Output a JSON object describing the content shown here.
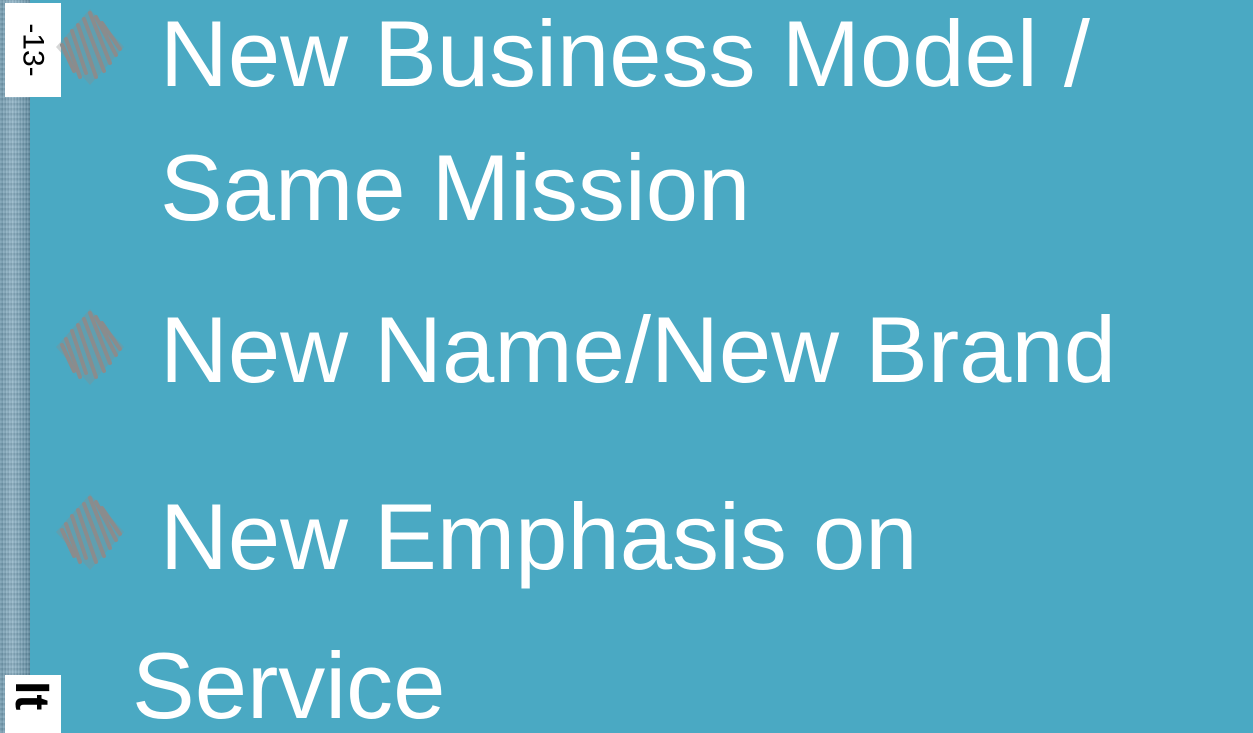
{
  "page_number": "-13-",
  "corner_fragment": "It",
  "bullets": [
    {
      "lines": [
        "New Business Model /",
        "Same Mission"
      ],
      "icon": "diamond-scribble-icon"
    },
    {
      "lines": [
        "New Name/New Brand"
      ],
      "icon": "diamond-scribble-icon"
    },
    {
      "lines": [
        "New Emphasis on",
        "Service"
      ],
      "icon": "diamond-scribble-icon"
    }
  ],
  "colors": {
    "background": "#4aa9c3",
    "text": "#ffffff",
    "bullet": "#8a8c8d"
  }
}
